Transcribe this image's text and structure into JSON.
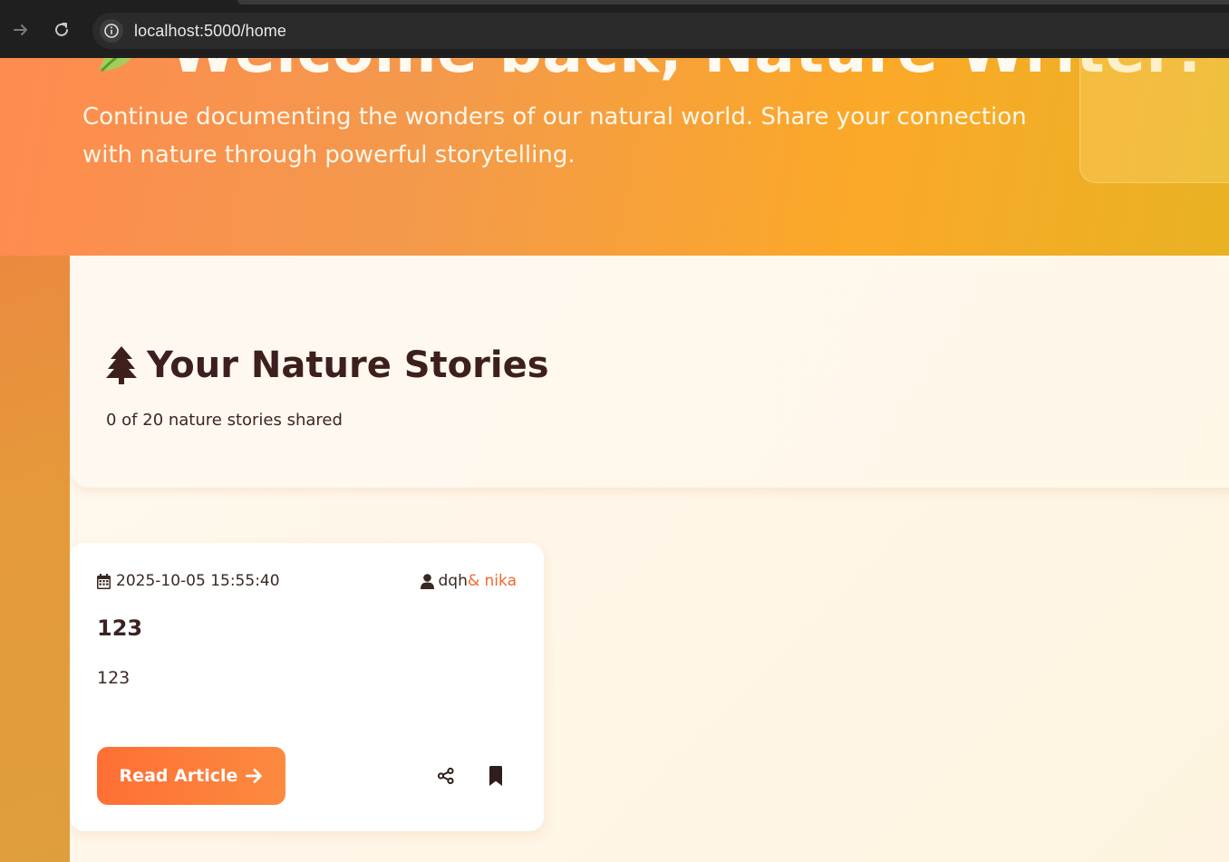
{
  "browser": {
    "url": "localhost:5000/home",
    "icons": {
      "forward": "arrow-right-icon",
      "reload": "reload-icon",
      "site_info": "info-icon"
    }
  },
  "hero": {
    "title": "Welcome back, Nature Writer!",
    "title_icon": "leaf-icon",
    "subtitle": "Continue documenting the wonders of our natural world. Share your connection with nature through powerful storytelling."
  },
  "stories": {
    "title": "Your Nature Stories",
    "title_icon": "tree-icon",
    "count_text": "0 of 20 nature stories shared"
  },
  "cards": [
    {
      "date": "2025-10-05 15:55:40",
      "author": "dqh",
      "coauthor": "& nika",
      "title": "123",
      "excerpt": "123",
      "read_label": "Read Article",
      "icons": [
        "calendar-icon",
        "user-icon",
        "arrow-right-icon",
        "share-icon",
        "bookmark-icon"
      ]
    }
  ],
  "colors": {
    "accent": "#ff6f35",
    "coauthor": "#f2682f",
    "heading": "#3d1f1c"
  }
}
